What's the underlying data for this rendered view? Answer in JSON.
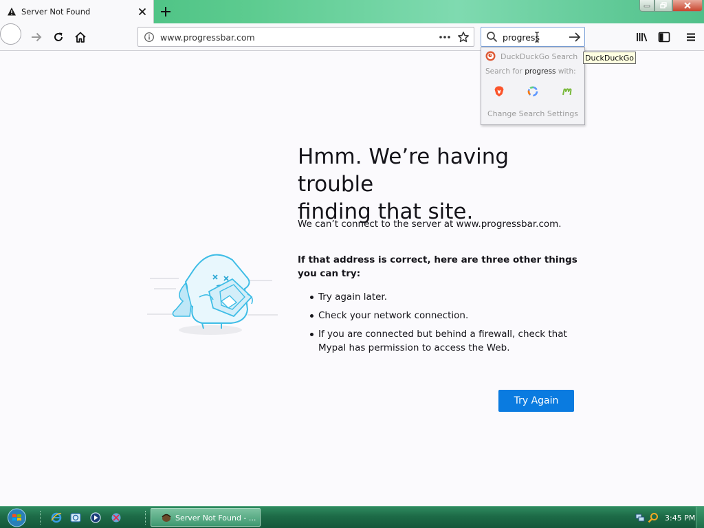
{
  "tab": {
    "title": "Server Not Found"
  },
  "toolbar": {
    "url": "www.progressbar.com",
    "search_value": "progress"
  },
  "search_popup": {
    "engine_name": "DuckDuckGo Search",
    "search_for_prefix": "Search for ",
    "search_term": "progress",
    "search_for_suffix": " with:",
    "settings_label": "Change Search Settings",
    "tooltip": "DuckDuckGo"
  },
  "error_page": {
    "title_line1": "Hmm. We’re having trouble",
    "title_line2": "finding that site.",
    "description": "We can’t connect to the server at www.progressbar.com.",
    "suggestions_heading": "If that address is correct, here are three other things you can try:",
    "suggestions": [
      "Try again later.",
      "Check your network connection.",
      "If you are connected but behind a firewall, check that Mypal has permission to access the Web."
    ],
    "try_again_label": "Try Again"
  },
  "taskbar": {
    "task_label": "Server Not Found - ...",
    "clock": "3:45 PM"
  },
  "colors": {
    "accent_button": "#0a7be0",
    "tab_strip": "#4fc089",
    "taskbar": "#1d6b47"
  }
}
